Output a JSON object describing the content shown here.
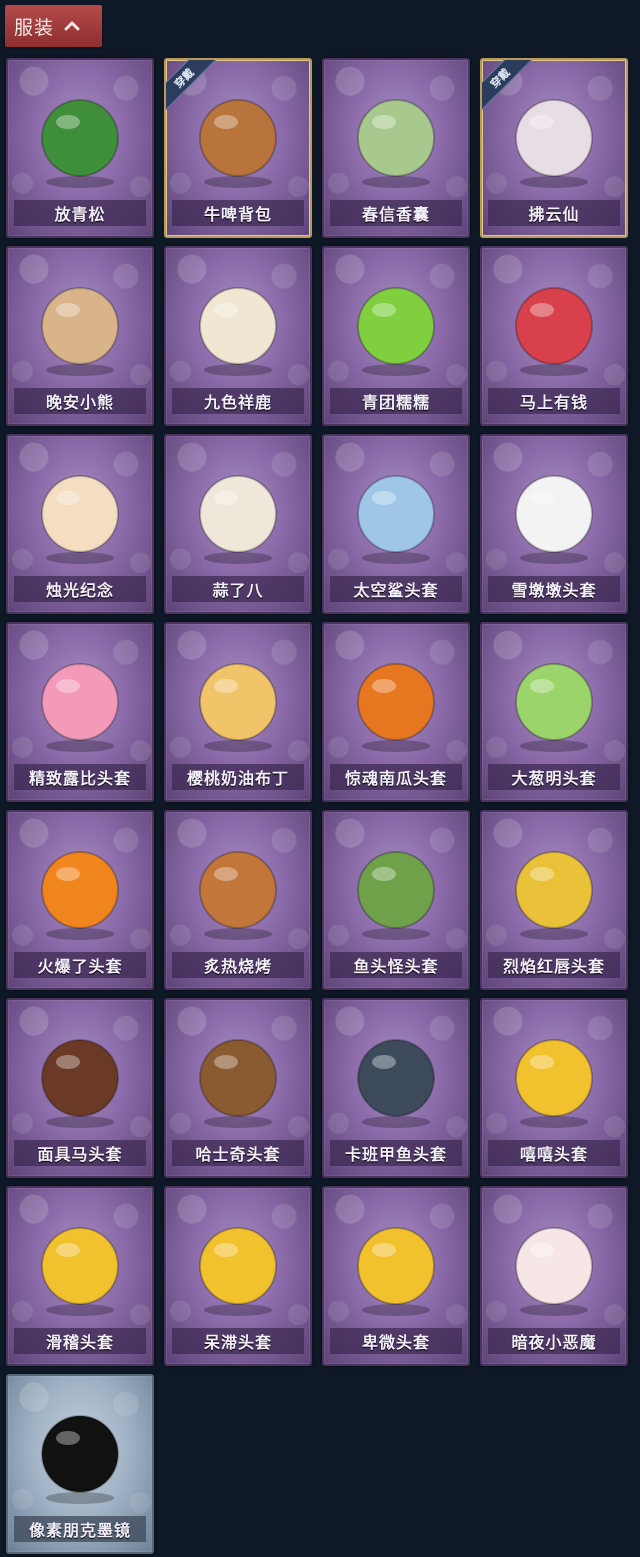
{
  "header": {
    "label": "服装"
  },
  "badge_text": "穿戴",
  "items": [
    {
      "label": "放青松",
      "worn": false,
      "icon": "bonsai-pine-icon",
      "color": "#3f8f3a",
      "frame": "purple"
    },
    {
      "label": "牛啤背包",
      "worn": true,
      "icon": "cow-beer-mug-icon",
      "color": "#b9743c",
      "frame": "purple"
    },
    {
      "label": "春信香囊",
      "worn": false,
      "icon": "sachet-icon",
      "color": "#a7c98e",
      "frame": "purple"
    },
    {
      "label": "拂云仙",
      "worn": true,
      "icon": "cloud-fairy-charm-icon",
      "color": "#e7dde4",
      "frame": "purple"
    },
    {
      "label": "晚安小熊",
      "worn": false,
      "icon": "bear-charm-icon",
      "color": "#d9b48a",
      "frame": "purple"
    },
    {
      "label": "九色祥鹿",
      "worn": false,
      "icon": "deer-charm-icon",
      "color": "#f0e6d2",
      "frame": "purple"
    },
    {
      "label": "青团糯糯",
      "worn": false,
      "icon": "green-dumpling-icon",
      "color": "#7fcf3f",
      "frame": "purple"
    },
    {
      "label": "马上有钱",
      "worn": false,
      "icon": "red-horse-icon",
      "color": "#d8414b",
      "frame": "purple"
    },
    {
      "label": "烛光纪念",
      "worn": false,
      "icon": "candle-icon",
      "color": "#f4ddc0",
      "frame": "purple"
    },
    {
      "label": "蒜了八",
      "worn": false,
      "icon": "garlic-icon",
      "color": "#efe8da",
      "frame": "purple"
    },
    {
      "label": "太空鲨头套",
      "worn": false,
      "icon": "shark-head-icon",
      "color": "#9fc6e6",
      "frame": "purple"
    },
    {
      "label": "雪墩墩头套",
      "worn": false,
      "icon": "snowman-head-icon",
      "color": "#f3f3f3",
      "frame": "purple"
    },
    {
      "label": "精致露比头套",
      "worn": false,
      "icon": "pink-beaver-head-icon",
      "color": "#f29ab8",
      "frame": "purple"
    },
    {
      "label": "樱桃奶油布丁",
      "worn": false,
      "icon": "pudding-icon",
      "color": "#f2c46a",
      "frame": "purple"
    },
    {
      "label": "惊魂南瓜头套",
      "worn": false,
      "icon": "pumpkin-head-icon",
      "color": "#e6761f",
      "frame": "purple"
    },
    {
      "label": "大葱明头套",
      "worn": false,
      "icon": "scallion-head-icon",
      "color": "#9bd46a",
      "frame": "purple"
    },
    {
      "label": "火爆了头套",
      "worn": false,
      "icon": "fire-head-icon",
      "color": "#f0851d",
      "frame": "purple"
    },
    {
      "label": "炙热烧烤",
      "worn": false,
      "icon": "bbq-meat-icon",
      "color": "#c2763a",
      "frame": "purple"
    },
    {
      "label": "鱼头怪头套",
      "worn": false,
      "icon": "fish-head-icon",
      "color": "#6fa14a",
      "frame": "purple"
    },
    {
      "label": "烈焰红唇头套",
      "worn": false,
      "icon": "yellow-mask-sunglasses-icon",
      "color": "#e9c23a",
      "frame": "purple"
    },
    {
      "label": "面具马头套",
      "worn": false,
      "icon": "horse-mask-icon",
      "color": "#6a3a26",
      "frame": "purple"
    },
    {
      "label": "哈士奇头套",
      "worn": false,
      "icon": "husky-head-icon",
      "color": "#8a5a30",
      "frame": "purple"
    },
    {
      "label": "卡班甲鱼头套",
      "worn": false,
      "icon": "fish-blob-head-icon",
      "color": "#3d4a5c",
      "frame": "purple"
    },
    {
      "label": "嘻嘻头套",
      "worn": false,
      "icon": "grin-emoji-icon",
      "color": "#f2c12e",
      "frame": "purple"
    },
    {
      "label": "滑稽头套",
      "worn": false,
      "icon": "smirk-emoji-icon",
      "color": "#f2c12e",
      "frame": "purple"
    },
    {
      "label": "呆滞头套",
      "worn": false,
      "icon": "stare-emoji-icon",
      "color": "#f2c12e",
      "frame": "purple"
    },
    {
      "label": "卑微头套",
      "worn": false,
      "icon": "humble-emoji-icon",
      "color": "#f2c12e",
      "frame": "purple"
    },
    {
      "label": "暗夜小恶魔",
      "worn": false,
      "icon": "little-devil-icon",
      "color": "#f6e6e6",
      "frame": "purple"
    },
    {
      "label": "像素朋克墨镜",
      "worn": false,
      "icon": "pixel-sunglasses-icon",
      "color": "#111111",
      "frame": "blue"
    }
  ]
}
